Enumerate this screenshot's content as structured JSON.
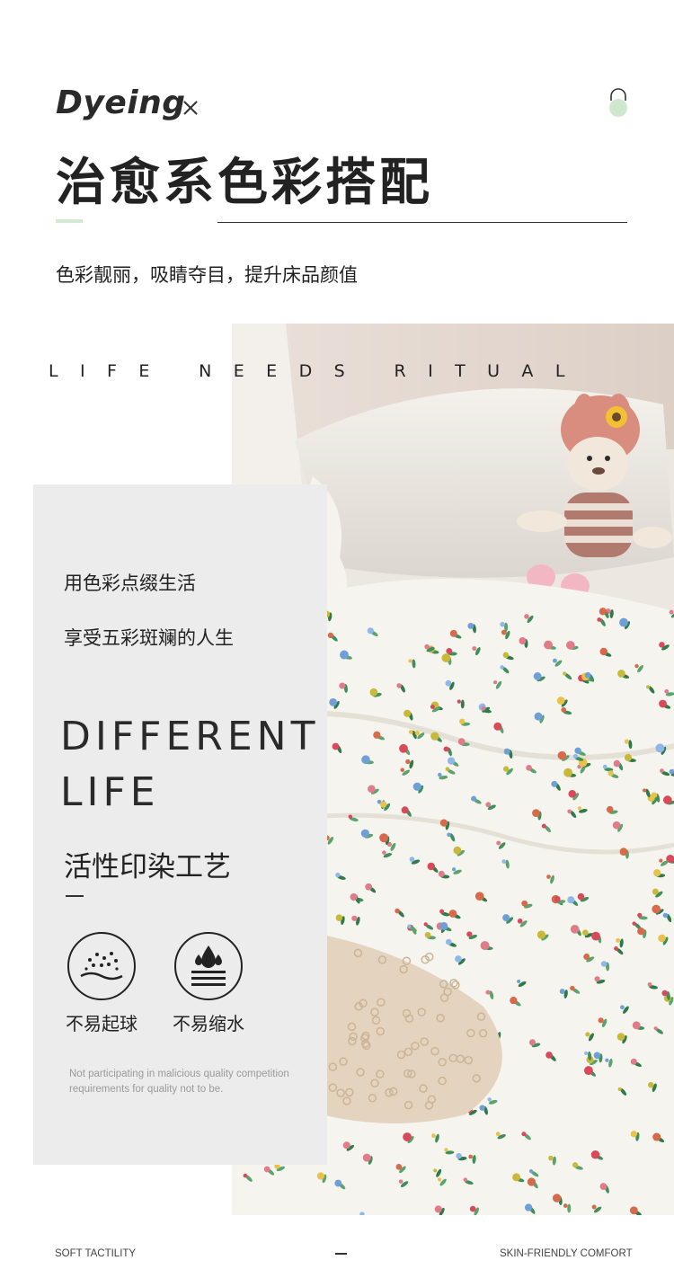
{
  "header": {
    "title_en": "Dyeing",
    "title_cn": "治愈系色彩搭配",
    "subtitle": "色彩靓丽，吸睛夺目，提升床品颜值",
    "icons": [
      "close-icon",
      "lock-icon"
    ],
    "accent_color": "#d2ead0"
  },
  "banner": {
    "ritual_text": "LIFE NEEDS RITUAL",
    "photo_icon": "floral-bedding-photo"
  },
  "card": {
    "line1": "用色彩点缀生活",
    "line2": "享受五彩斑斓的人生",
    "big_en_line1": "DIFFERENT",
    "big_en_line2": "LIFE",
    "craft_title": "活性印染工艺",
    "features": [
      {
        "icon": "anti-pilling-icon",
        "label": "不易起球"
      },
      {
        "icon": "anti-shrink-icon",
        "label": "不易缩水"
      }
    ],
    "note": "Not participating in malicious quality competition requirements for quality not to be.",
    "background": "#ececec"
  },
  "footer": {
    "left": "SOFT TACTILITY",
    "right": "SKIN-FRIENDLY COMFORT"
  }
}
